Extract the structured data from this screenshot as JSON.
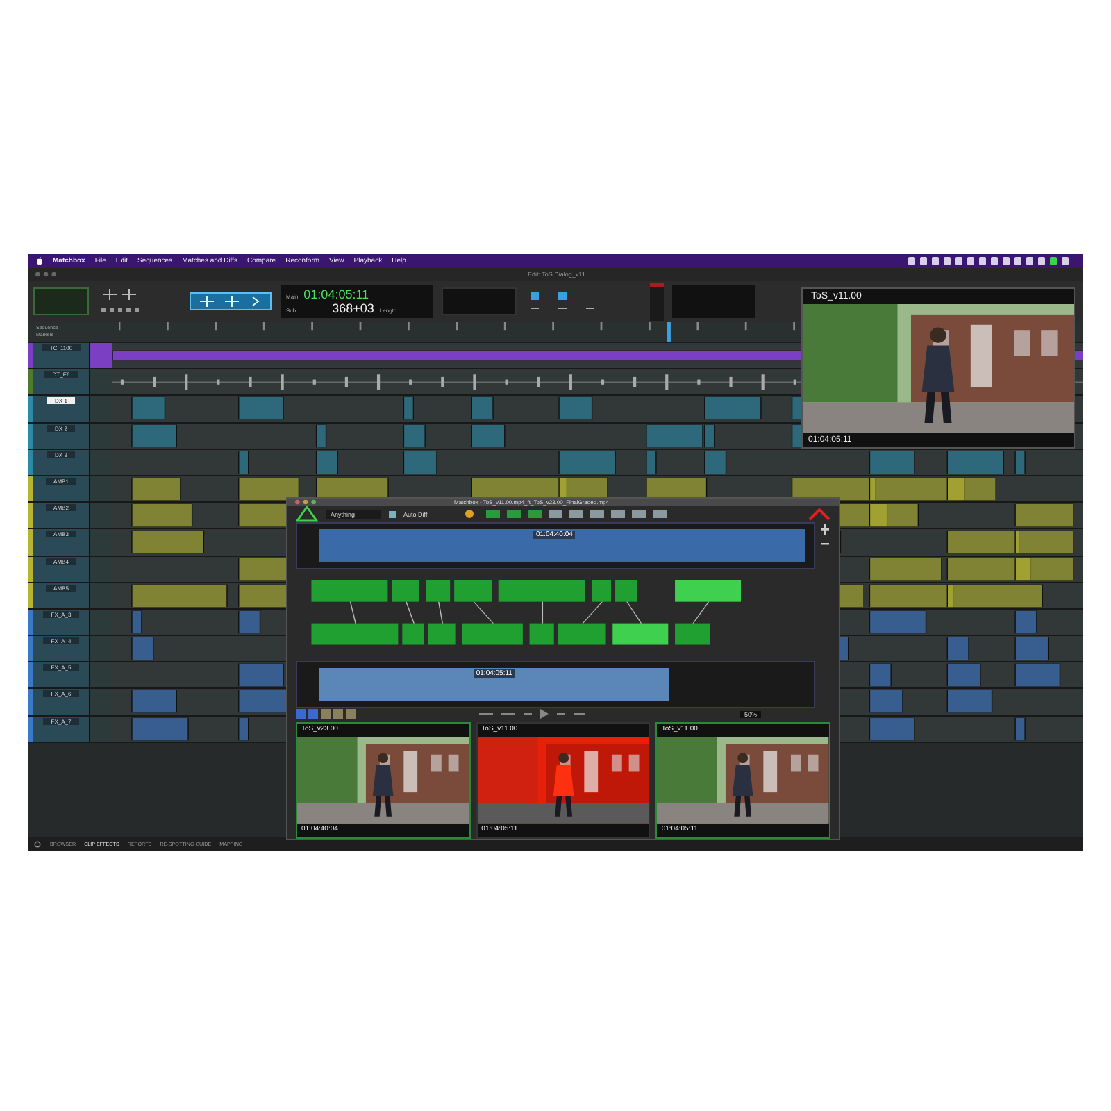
{
  "menu_bar": {
    "app": "Matchbox",
    "items": [
      "File",
      "Edit",
      "Sequences",
      "Matches and Diffs",
      "Compare",
      "Reconform",
      "View",
      "Playback",
      "Help"
    ]
  },
  "window": {
    "title": "Edit: ToS Dialog_v11"
  },
  "counters": {
    "main_label": "Main",
    "main": "01:04:05:11",
    "sub_label": "Sub",
    "sub": "368+03",
    "length_label": "Length"
  },
  "ruler_labels": [
    "Sequence",
    "Markers"
  ],
  "tracks": [
    {
      "name": "TC_1100",
      "kind": "timecode",
      "color": "#7b3fc4",
      "selected": false
    },
    {
      "name": "DT_E6",
      "kind": "guide",
      "color": "#4f7a2a",
      "selected": false
    },
    {
      "name": "DX 1",
      "kind": "audio",
      "color": "#2a8aa8",
      "selected": true
    },
    {
      "name": "DX 2",
      "kind": "audio",
      "color": "#2a8aa8",
      "selected": false
    },
    {
      "name": "DX 3",
      "kind": "audio",
      "color": "#2a8aa8",
      "selected": false
    },
    {
      "name": "AMB1",
      "kind": "audio",
      "color": "#b5b532",
      "selected": false
    },
    {
      "name": "AMB2",
      "kind": "audio",
      "color": "#b5b532",
      "selected": false
    },
    {
      "name": "AMB3",
      "kind": "audio",
      "color": "#b5b532",
      "selected": false
    },
    {
      "name": "AMB4",
      "kind": "audio",
      "color": "#b5b532",
      "selected": false
    },
    {
      "name": "AMB5",
      "kind": "audio",
      "color": "#b5b532",
      "selected": false
    },
    {
      "name": "FX_A_3",
      "kind": "audio",
      "color": "#3a78c8",
      "selected": false
    },
    {
      "name": "FX_A_4",
      "kind": "audio",
      "color": "#3a78c8",
      "selected": false
    },
    {
      "name": "FX_A_5",
      "kind": "audio",
      "color": "#3a78c8",
      "selected": false
    },
    {
      "name": "FX_A_6",
      "kind": "audio",
      "color": "#3a78c8",
      "selected": false
    },
    {
      "name": "FX_A_7",
      "kind": "audio",
      "color": "#3a78c8",
      "selected": false
    }
  ],
  "bottom_tabs": [
    {
      "label": "BROWSER",
      "selected": false
    },
    {
      "label": "CLIP EFFECTS",
      "selected": true
    },
    {
      "label": "REPORTS",
      "selected": false
    },
    {
      "label": "RE-SPOTTING GUIDE",
      "selected": false
    },
    {
      "label": "MAPPING",
      "selected": false
    }
  ],
  "viewer": {
    "title": "ToS_v11.00",
    "timecode": "01:04:05:11"
  },
  "dialog": {
    "title": "Matchbox - ToS_v11.00.mp4_ft_ToS_v23.00_FinalGraded.mp4",
    "filter": "Anything",
    "auto_diff": {
      "label": "Auto Diff",
      "checked": false
    },
    "top_timecode": "01:04:40:04",
    "bottom_timecode": "01:04:05:11",
    "zoom": "50%",
    "thumbnails": [
      {
        "title": "ToS_v23.00",
        "timecode": "01:04:40:04",
        "kind": "normal"
      },
      {
        "title": "ToS_v11.00",
        "timecode": "01:04:05:11",
        "kind": "diff"
      },
      {
        "title": "ToS_v11.00",
        "timecode": "01:04:05:11",
        "kind": "normal"
      }
    ]
  }
}
